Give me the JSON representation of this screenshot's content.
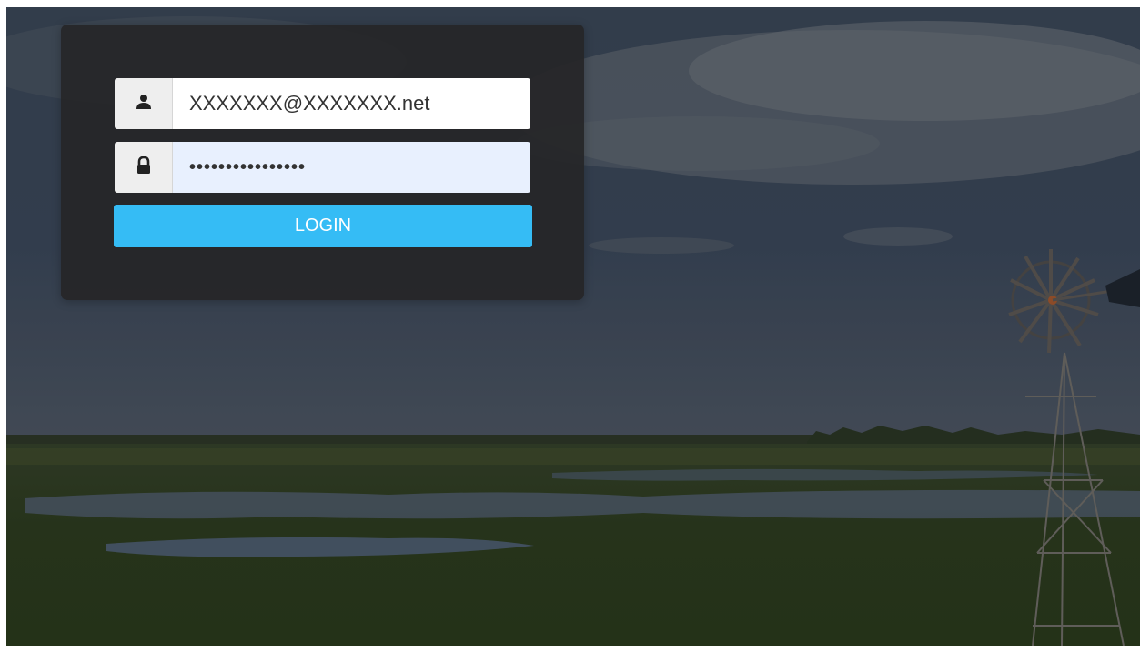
{
  "login": {
    "username_value": "XXXXXXX@XXXXXXX.net",
    "password_value": "••••••••••••••••",
    "button_label": "LOGIN"
  },
  "icons": {
    "username": "user-icon",
    "password": "lock-icon"
  },
  "colors": {
    "accent": "#35bcf5",
    "panel": "#262628",
    "password_field_bg": "#e8f0fe"
  }
}
